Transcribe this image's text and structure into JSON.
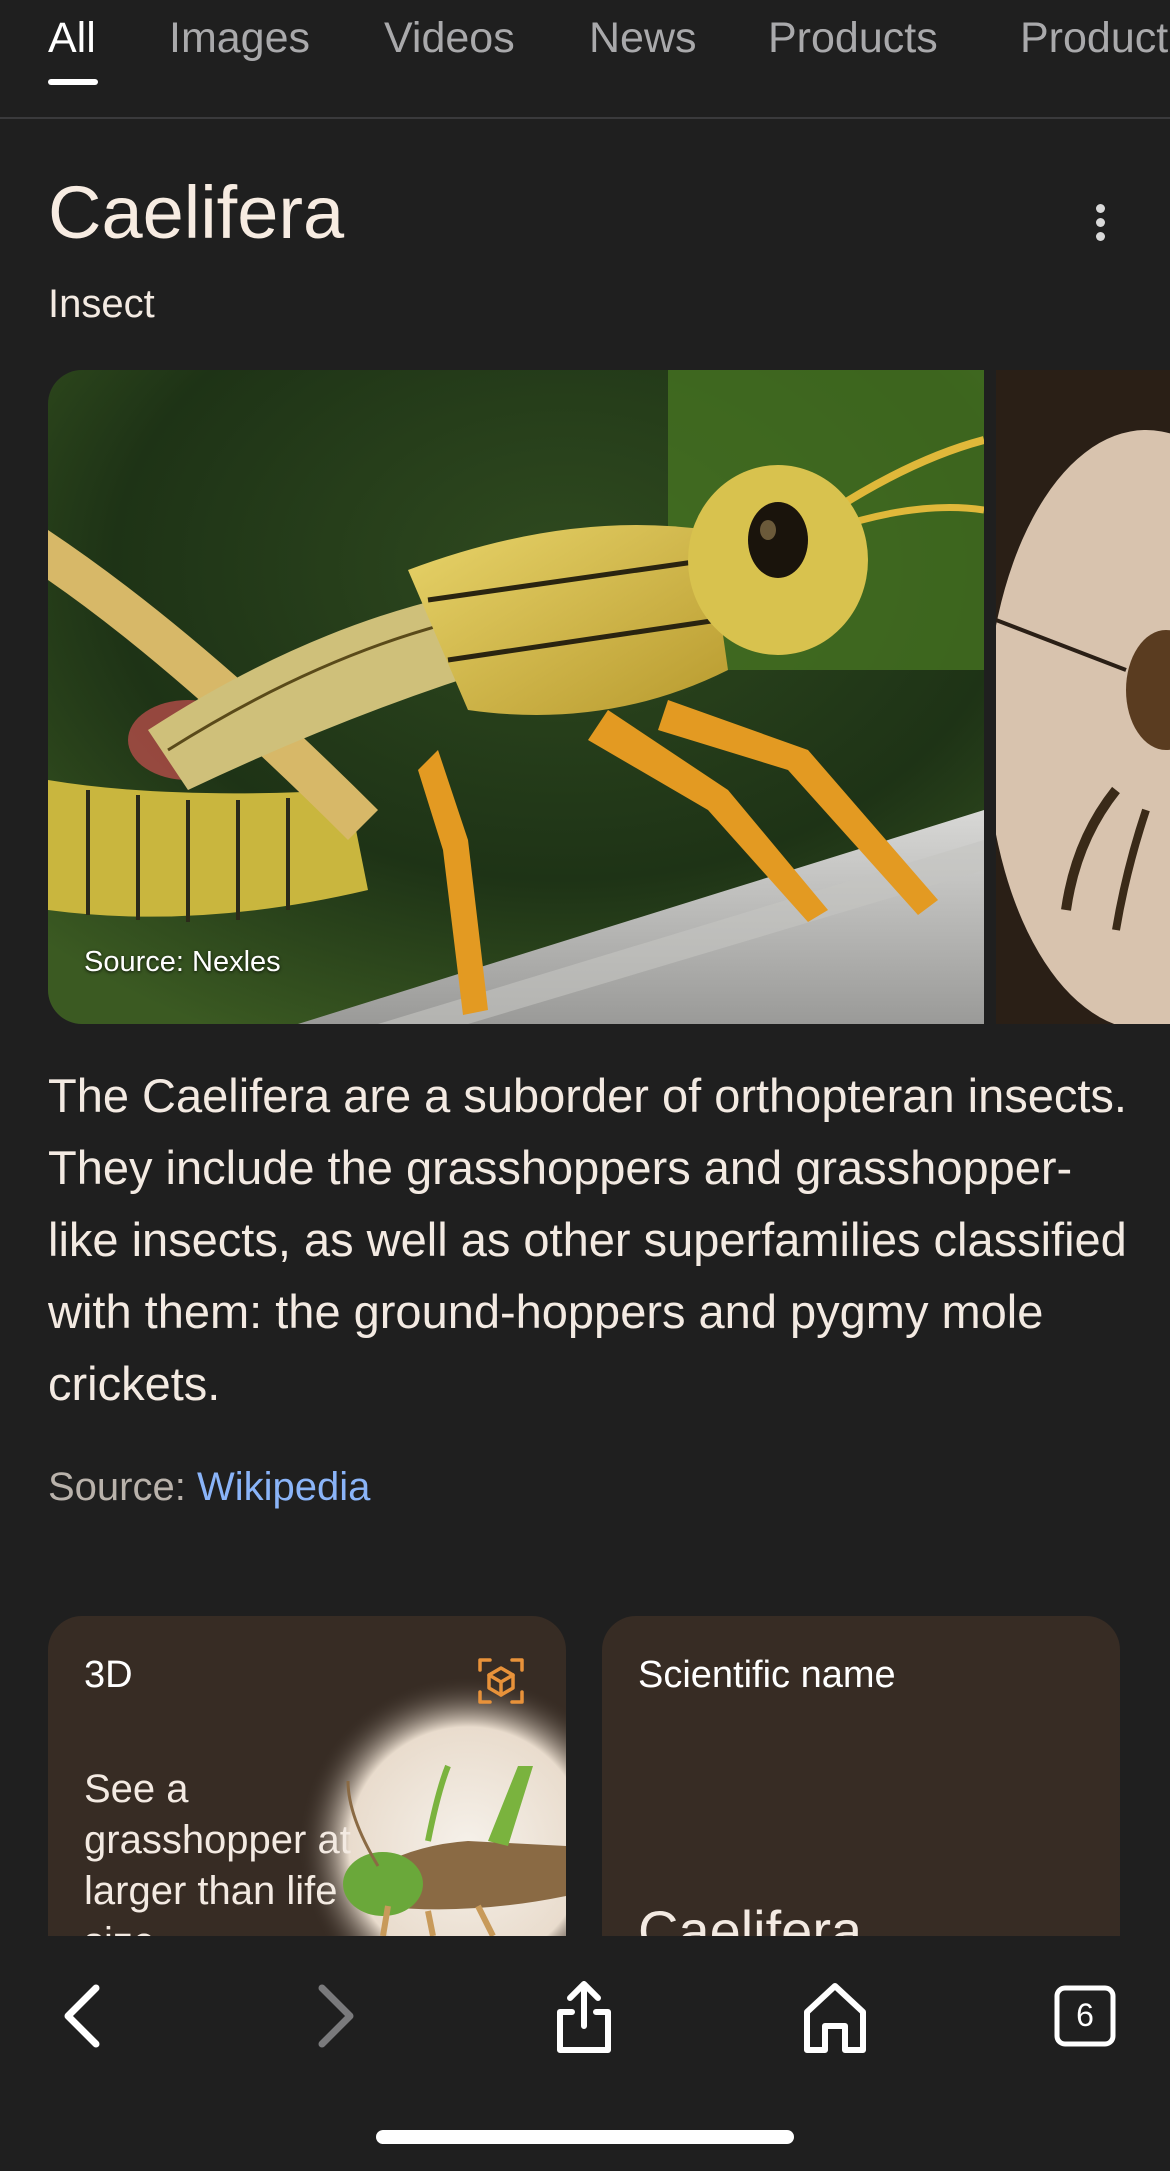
{
  "tabs": [
    {
      "label": "All",
      "active": true
    },
    {
      "label": "Images",
      "active": false
    },
    {
      "label": "Videos",
      "active": false
    },
    {
      "label": "News",
      "active": false
    },
    {
      "label": "Products",
      "active": false
    },
    {
      "label": "Product",
      "active": false
    }
  ],
  "entity": {
    "title": "Caelifera",
    "subtitle": "Insect",
    "image_source": "Source: Nexles",
    "description": "The Caelifera are a suborder of orthopteran insects. They include the grasshoppers and grasshopper-like insects, as well as other superfamilies classified with them: the ground-hoppers and pygmy mole crickets.",
    "source_label": "Source: ",
    "source_link": "Wikipedia"
  },
  "cards": {
    "three_d": {
      "label": "3D",
      "text": "See a grasshopper at larger than life size"
    },
    "scientific": {
      "label": "Scientific name",
      "value": "Caelifera"
    }
  },
  "toolbar": {
    "tab_count": "6"
  },
  "colors": {
    "background": "#1f1f1f",
    "card": "#372c24",
    "link": "#8ab4f8",
    "ar_accent": "#e8923a"
  }
}
